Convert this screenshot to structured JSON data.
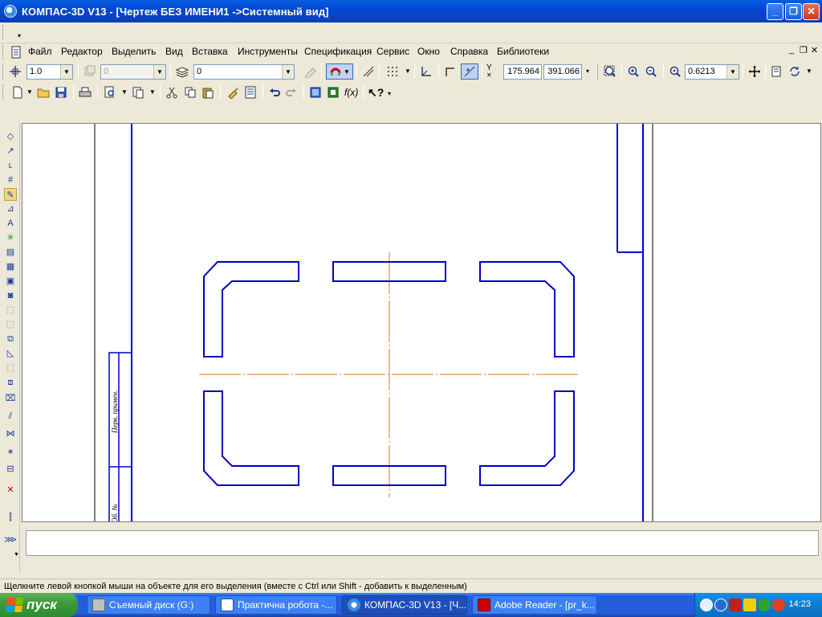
{
  "window": {
    "title": "КОМПАС-3D V13 - [Чертеж БЕЗ ИМЕНИ1 ->Системный вид]"
  },
  "menu": {
    "items": [
      "Файл",
      "Редактор",
      "Выделить",
      "Вид",
      "Вставка",
      "Инструменты",
      "Спецификация",
      "Сервис",
      "Окно",
      "Справка",
      "Библиотеки"
    ]
  },
  "toolbar1": {
    "step_value": "1.0",
    "layer_value": "0",
    "style_value": "0",
    "coord_x": "175.964",
    "coord_y": "391.066",
    "zoom_value": "0.6213"
  },
  "drawing": {
    "stamp_text_1": "Перв. примен.",
    "stamp_text_2": "Об. №"
  },
  "statusbar": {
    "hint": "Щелкните левой кнопкой мыши на объекте для его выделения (вместе с Ctrl или Shift - добавить к выделенным)"
  },
  "taskbar": {
    "start_label": "пуск",
    "tasks": [
      "Съемный диск (G:)",
      "Практична робота -...",
      "КОМПАС-3D V13 - [Ч...",
      "Adobe Reader - [pr_k..."
    ],
    "clock": "14:23"
  },
  "colors": {
    "outline": "#0000c8",
    "axis": "#e07a10",
    "title_bar": "#0a50d8"
  }
}
